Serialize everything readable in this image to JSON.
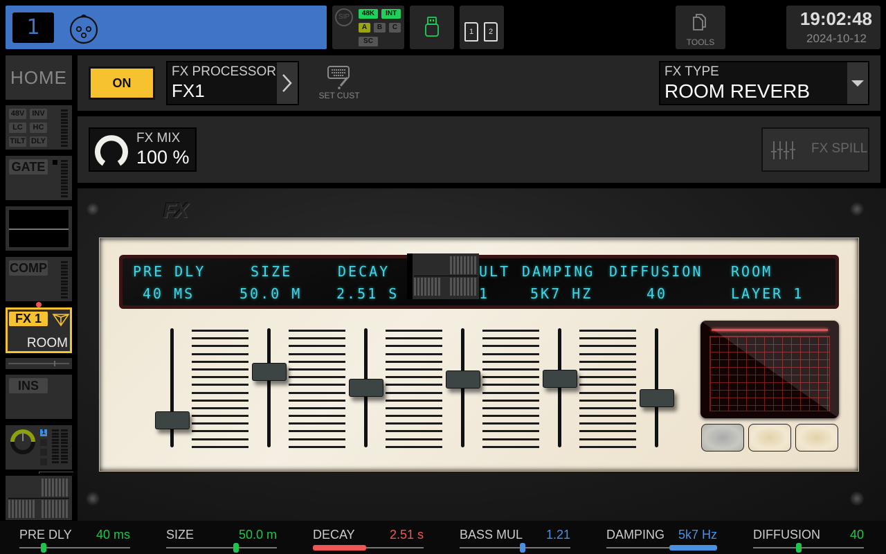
{
  "topbar": {
    "channel_number": "1",
    "channel_color": "#3f74c7",
    "channel_icon": "xlr-input-icon",
    "status": {
      "sip_label": "SIP",
      "sample_rate": "48K",
      "clock_source": "INT",
      "buses": [
        "A",
        "B",
        "C"
      ],
      "sc_label": "SC"
    },
    "usb_icon": "usb-drive-icon",
    "sd_cards": [
      "1",
      "2"
    ],
    "tools_label": "TOOLS",
    "time": "19:02:48",
    "date": "2024-10-12"
  },
  "sidebar": {
    "home_label": "HOME",
    "input_flags": [
      "48V",
      "INV",
      "LC",
      "HC",
      "TILT",
      "DLY"
    ],
    "gate_label": "GATE",
    "comp_label": "COMP",
    "fx_slot_label": "FX 1",
    "fx_slot_type": "ROOM",
    "ins_label": "INS",
    "send_badge": "1"
  },
  "header": {
    "on_label": "ON",
    "fx_processor_label": "FX PROCESSOR",
    "fx_processor_value": "FX1",
    "set_cust_label": "SET CUST",
    "fx_type_label": "FX TYPE",
    "fx_type_value": "ROOM REVERB",
    "fx_mix_label": "FX MIX",
    "fx_mix_value": "100 %",
    "fx_spill_label": "FX SPILL"
  },
  "rack": {
    "logo": "FX",
    "lcd_names": [
      "PRE DLY",
      "SIZE",
      "DECAY",
      "ULT",
      "DAMPING",
      "DIFFUSION",
      "ROOM"
    ],
    "lcd_values": [
      "40 MS",
      "50.0 M",
      "2.51 S",
      "1",
      "5K7 HZ",
      "40",
      "LAYER 1"
    ],
    "faders": [
      {
        "name": "pre-dly",
        "value": 0.18
      },
      {
        "name": "size",
        "value": 0.66
      },
      {
        "name": "decay",
        "value": 0.5
      },
      {
        "name": "bass-mul",
        "value": 0.58
      },
      {
        "name": "damping",
        "value": 0.59
      },
      {
        "name": "diffusion",
        "value": 0.4
      }
    ],
    "preset_buttons": [
      "preset-1",
      "preset-2",
      "preset-3"
    ]
  },
  "bottom": {
    "params": [
      {
        "name": "PRE DLY",
        "value": "40 ms",
        "color": "#1fc44d",
        "type": "thumb",
        "pos": 0.22
      },
      {
        "name": "SIZE",
        "value": "50.0 m",
        "color": "#1fc44d",
        "type": "thumb",
        "pos": 0.63
      },
      {
        "name": "DECAY",
        "value": "2.51 s",
        "color": "#ee5656",
        "type": "bar",
        "from": 0.0,
        "to": 0.48
      },
      {
        "name": "BASS MUL",
        "value": "1.21",
        "color": "#4a90e2",
        "type": "thumb",
        "pos": 0.57
      },
      {
        "name": "DAMPING",
        "value": "5k7 Hz",
        "color": "#4a90e2",
        "type": "bar",
        "from": 0.57,
        "to": 1.0
      },
      {
        "name": "DIFFUSION",
        "value": "40",
        "color": "#1fc44d",
        "type": "thumb",
        "pos": 0.41
      }
    ]
  }
}
